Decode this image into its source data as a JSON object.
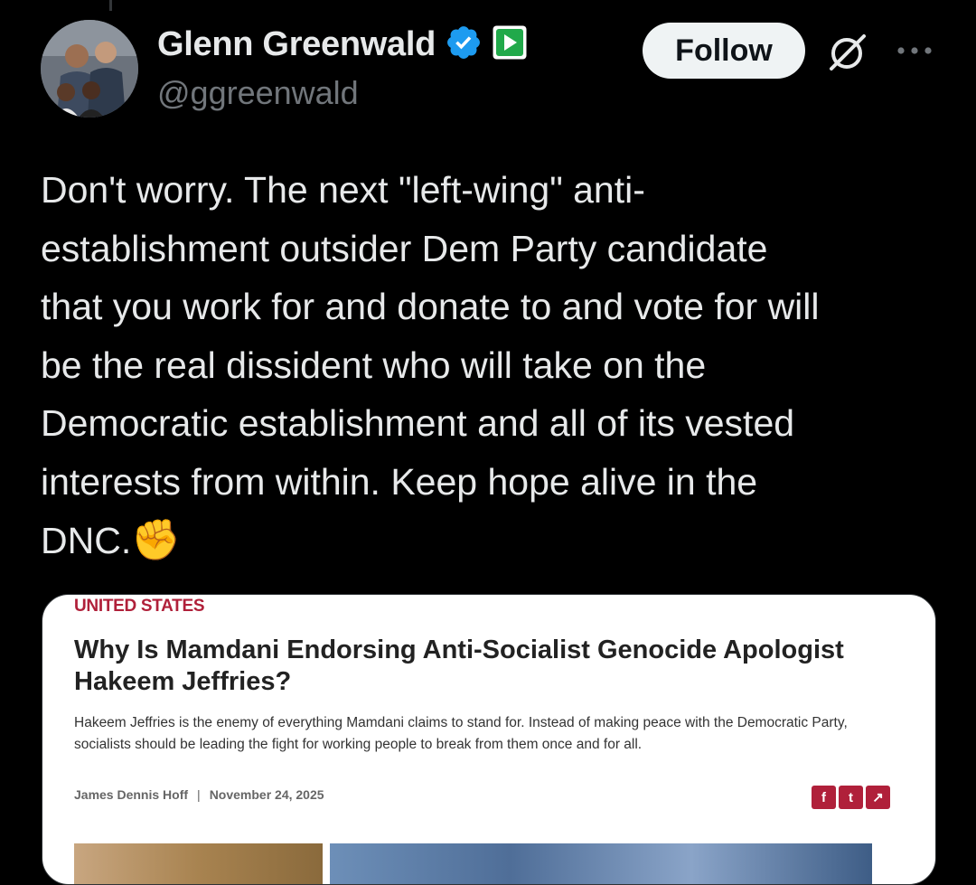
{
  "author": {
    "name": "Glenn Greenwald",
    "handle": "@ggreenwald",
    "verified_icon": "verified-badge-icon",
    "subscription_icon": "play-badge-icon"
  },
  "actions": {
    "follow_label": "Follow",
    "grok_icon": "grok-icon",
    "more_icon": "more-icon"
  },
  "tweet": {
    "text": "Don't worry. The next \"left-wing\" anti-\nestablishment outsider Dem Party candidate\nthat you work for and donate to and vote for will\nbe the real dissident who will take on the\nDemocratic establishment and all of its vested\ninterests from within. Keep hope alive in the\nDNC.",
    "emoji": "✊"
  },
  "card": {
    "kicker": "UNITED STATES",
    "headline": "Why Is Mamdani Endorsing Anti-Socialist Genocide Apologist Hakeem Jeffries?",
    "dek": "Hakeem Jeffries is the enemy of everything Mamdani claims to stand for. Instead of making peace with the Democratic Party, socialists should be leading the fight for working people to break from them once and for all.",
    "author": "James Dennis Hoff",
    "separator": "|",
    "date": "November 24, 2025",
    "share": [
      "f",
      "t",
      "↗"
    ]
  },
  "colors": {
    "background": "#000000",
    "text": "#e7e9ea",
    "muted": "#71767b",
    "verified": "#1d9bf0",
    "kicker": "#b0203a"
  }
}
